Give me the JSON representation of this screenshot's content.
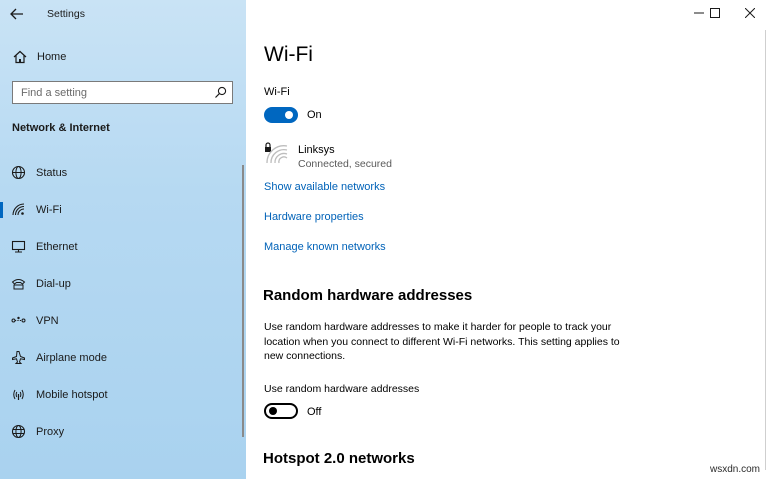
{
  "app": {
    "title": "Settings"
  },
  "home": {
    "label": "Home"
  },
  "search": {
    "placeholder": "Find a setting"
  },
  "sidebar": {
    "section": "Network & Internet",
    "items": [
      {
        "label": "Status",
        "icon": "globe-icon"
      },
      {
        "label": "Wi-Fi",
        "icon": "wifi-icon",
        "selected": true
      },
      {
        "label": "Ethernet",
        "icon": "ethernet-icon"
      },
      {
        "label": "Dial-up",
        "icon": "dialup-icon"
      },
      {
        "label": "VPN",
        "icon": "vpn-icon"
      },
      {
        "label": "Airplane mode",
        "icon": "airplane-icon"
      },
      {
        "label": "Mobile hotspot",
        "icon": "hotspot-icon"
      },
      {
        "label": "Proxy",
        "icon": "proxy-icon"
      }
    ]
  },
  "main": {
    "title": "Wi-Fi",
    "wifi_toggle": {
      "label": "Wi-Fi",
      "state": "On",
      "on": true
    },
    "network": {
      "name": "Linksys",
      "status": "Connected, secured"
    },
    "links": [
      "Show available networks",
      "Hardware properties",
      "Manage known networks"
    ],
    "random_hw": {
      "heading": "Random hardware addresses",
      "description": "Use random hardware addresses to make it harder for people to track your location when you connect to different Wi-Fi networks. This setting applies to new connections.",
      "toggle_label": "Use random hardware addresses",
      "state": "Off",
      "on": false
    },
    "hotspot": {
      "heading": "Hotspot 2.0 networks"
    }
  },
  "watermark": "wsxdn.com",
  "colors": {
    "accent": "#0067c0",
    "link": "#0062b8",
    "sidebar_bg": "#b6d9f2"
  }
}
